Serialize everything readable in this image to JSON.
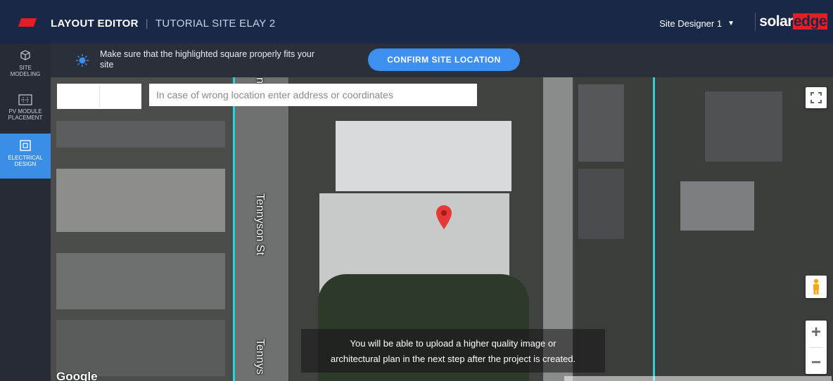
{
  "header": {
    "title": "LAYOUT EDITOR",
    "site_name": "TUTORIAL SITE ELAY 2",
    "user_menu": "Site Designer 1",
    "brand_solar": "solar",
    "brand_edge": "edge"
  },
  "sidebar": {
    "items": [
      {
        "label_line1": "SITE",
        "label_line2": "MODELING",
        "icon": "cube-icon"
      },
      {
        "label_line1": "PV MODULE",
        "label_line2": "PLACEMENT",
        "icon": "grid-icon"
      },
      {
        "label_line1": "ELECTRICAL",
        "label_line2": "DESIGN",
        "icon": "electrical-icon"
      }
    ]
  },
  "infobar": {
    "message_line1": "Make sure that the highlighted square properly fits your",
    "message_line2": "site",
    "confirm_label": "CONFIRM SITE LOCATION"
  },
  "map": {
    "search_placeholder": "In case of wrong location enter address or coordinates",
    "street_top": "n St",
    "street_mid": "Tennyson St",
    "street_bottom": "Tennys",
    "upload_notice_line1": "You will be able to upload a higher quality image or",
    "upload_notice_line2": "architectural plan in the next step after the project is created.",
    "google_logo": "Google",
    "zoom_in": "+",
    "zoom_out": "−"
  },
  "colors": {
    "header_bg": "#1a2847",
    "accent_blue": "#3d8ff0",
    "brand_red": "#e31e24",
    "boundary_cyan": "#2fd1d8"
  }
}
